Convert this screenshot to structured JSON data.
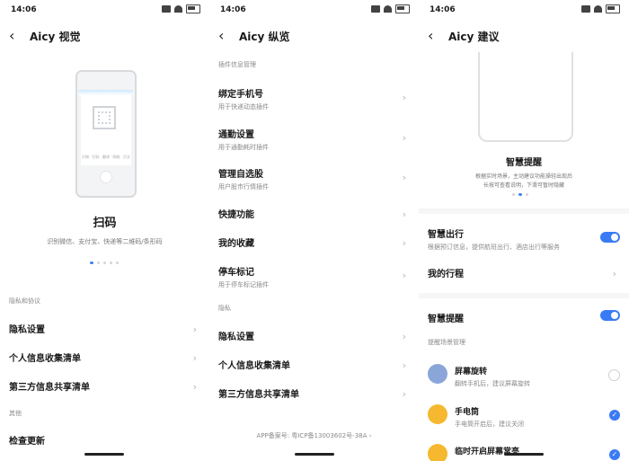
{
  "status": {
    "time": "14:06"
  },
  "panel1": {
    "back_label": "‹",
    "title": "Aicy 视觉",
    "phone_tabs": [
      "识物",
      "扫码",
      "翻译",
      "购物",
      "识文"
    ],
    "feature_title": "扫码",
    "feature_desc": "识别微信、支付宝、快递等二维码/条形码",
    "sections": [
      {
        "header": "隐私和协议",
        "items": [
          "隐私设置",
          "个人信息收集清单",
          "第三方信息共享清单"
        ]
      },
      {
        "header": "其他",
        "items": [
          "检查更新"
        ]
      }
    ]
  },
  "panel2": {
    "back_label": "‹",
    "title": "Aicy 纵览",
    "section_plugin": "插件信息管理",
    "plugins": [
      {
        "label": "绑定手机号",
        "sub": "用于快递动态插件"
      },
      {
        "label": "通勤设置",
        "sub": "用于通勤耗时插件"
      },
      {
        "label": "管理自选股",
        "sub": "用户股市行情插件"
      },
      {
        "label": "快捷功能",
        "sub": ""
      },
      {
        "label": "我的收藏",
        "sub": ""
      },
      {
        "label": "停车标记",
        "sub": "用于停车标记插件"
      }
    ],
    "section_privacy": "隐私",
    "privacy_items": [
      "隐私设置",
      "个人信息收集清单",
      "第三方信息共享清单"
    ],
    "footer": "APP备案号: 粤ICP备13003602号-38A"
  },
  "panel3": {
    "back_label": "‹",
    "title": "Aicy 建议",
    "feature_title": "智慧提醒",
    "feature_desc_1": "根据实时场景，主动建议功能操轻出现后",
    "feature_desc_2": "长按可查看说明，下滑可暂时隐藏",
    "smart_travel": {
      "label": "智慧出行",
      "sub": "根据预订信息，提供航班出行、酒店出行等服务"
    },
    "my_trip": "我的行程",
    "smart_remind": "智慧提醒",
    "scene_header": "提醒场景管理",
    "scenes": [
      {
        "label": "屏幕旋转",
        "sub": "翻转手机后，建议屏幕旋转",
        "checked": false
      },
      {
        "label": "手电筒",
        "sub": "手电筒开启后，建议关闭",
        "checked": true
      },
      {
        "label": "临时开启屏幕常亮",
        "sub": "",
        "checked": true
      }
    ]
  }
}
